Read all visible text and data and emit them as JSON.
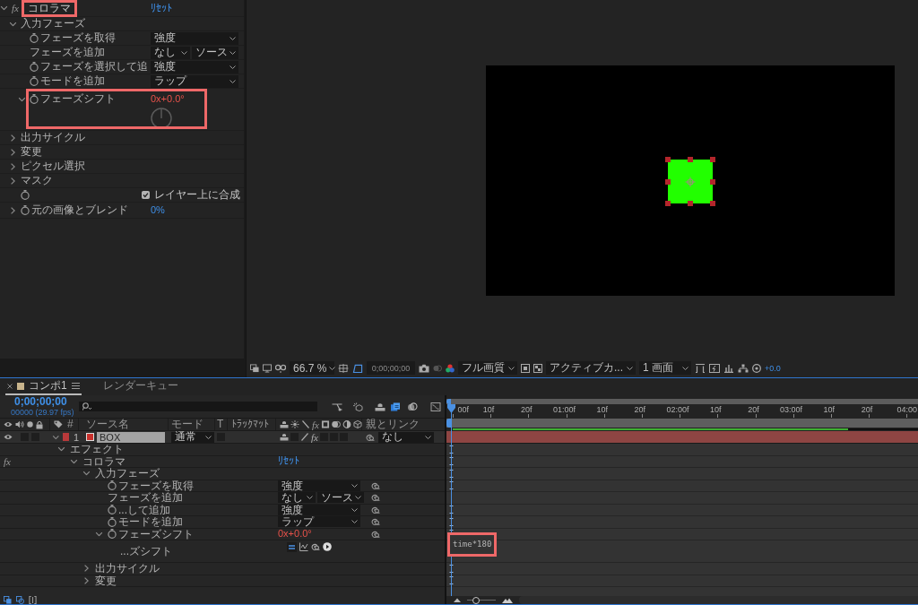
{
  "effect_controls": {
    "effect": {
      "fx_label": "fx",
      "name": "コロラマ",
      "reset": "ﾘｾｯﾄ",
      "expanded": true,
      "highlighted": true
    },
    "properties": [
      {
        "kind": "group",
        "label": "入力フェーズ",
        "expanded": true,
        "children": [
          {
            "kind": "dropdown",
            "label": "フェーズを取得",
            "stopwatch": true,
            "values": [
              "強度"
            ],
            "highlighted": false
          },
          {
            "kind": "dropdown",
            "label": "フェーズを追加",
            "stopwatch": false,
            "values": [
              "なし",
              "ソース"
            ],
            "highlighted": false
          },
          {
            "kind": "dropdown",
            "label": "フェーズを選択して追",
            "stopwatch": true,
            "values": [
              "強度"
            ],
            "highlighted": false
          },
          {
            "kind": "dropdown",
            "label": "モードを追加",
            "stopwatch": true,
            "values": [
              "ラップ"
            ],
            "highlighted": false
          },
          {
            "kind": "angle",
            "label": "フェーズシフト",
            "stopwatch": true,
            "expanded": true,
            "expression": true,
            "value": "0x+0.0°",
            "highlighted": true
          }
        ]
      },
      {
        "kind": "group",
        "label": "出力サイクル",
        "expanded": false
      },
      {
        "kind": "group",
        "label": "変更",
        "expanded": false
      },
      {
        "kind": "group",
        "label": "ピクセル選択",
        "expanded": false
      },
      {
        "kind": "group",
        "label": "マスク",
        "expanded": false
      },
      {
        "kind": "checkbox",
        "stopwatch": true,
        "text": "レイヤー上に合成",
        "checked": true
      },
      {
        "kind": "slider",
        "label": "元の画像とブレンド",
        "stopwatch": true,
        "expanded": false,
        "value": "0%"
      }
    ]
  },
  "viewer": {
    "layer": {
      "selected": true
    },
    "toolbar": {
      "zoom": "66.7 %",
      "timecode": "0;00;00;00",
      "quality": "フル画質",
      "camera": "アクティブカ...",
      "views": "1 画面",
      "exposure": "+0.0"
    }
  },
  "timeline": {
    "tabs": [
      {
        "label": "コンポ1",
        "selected": true
      },
      {
        "label": "レンダーキュー",
        "selected": false
      }
    ],
    "current_time": "0;00;00;00",
    "frame_info": "00000 (29.97 fps)",
    "columns": {
      "number": "#",
      "source_name": "ソース名",
      "mode": "モード",
      "t": "T",
      "track_matte": "ﾄﾗｯｸﾏｯﾄ",
      "effects": "fx",
      "parent": "親とリンク"
    },
    "layer": {
      "number": "1",
      "name": "BOX",
      "mode": "通常",
      "effects": "fx",
      "effects_enabled": true,
      "parent": "なし",
      "visible": true,
      "expanded": true,
      "selected": true
    },
    "ruler": [
      "00f",
      "10f",
      "20f",
      "01:00f",
      "10f",
      "20f",
      "02:00f",
      "10f",
      "20f",
      "03:00f",
      "10f",
      "20f",
      "04:00"
    ],
    "cache": {
      "level": 0.85
    },
    "zoom_slider": {
      "level": 0.3
    },
    "tree": [
      {
        "kind": "group",
        "label": "エフェクト",
        "expanded": true,
        "children": [
          {
            "kind": "effect",
            "fx_label": "fx",
            "label": "コロラマ",
            "reset": "ﾘｾｯﾄ",
            "expanded": true,
            "children": [
              {
                "kind": "group",
                "label": "入力フェーズ",
                "expanded": true,
                "children": [
                  {
                    "kind": "dropdown",
                    "label": "フェーズを取得",
                    "stopwatch": true,
                    "values": [
                      "強度"
                    ]
                  },
                  {
                    "kind": "dropdown",
                    "label": "フェーズを追加",
                    "stopwatch": false,
                    "values": [
                      "なし",
                      "ソース"
                    ]
                  },
                  {
                    "kind": "dropdown",
                    "label": "...して追加",
                    "stopwatch": true,
                    "values": [
                      "強度"
                    ]
                  },
                  {
                    "kind": "dropdown",
                    "label": "モードを追加",
                    "stopwatch": true,
                    "values": [
                      "ラップ"
                    ]
                  },
                  {
                    "kind": "angle",
                    "label": "フェーズシフト",
                    "stopwatch": true,
                    "expanded": true,
                    "expression": true,
                    "value": "0x+0.0°",
                    "children": [
                      {
                        "kind": "expression",
                        "label": "...ズシフト",
                        "code": "time*180",
                        "highlighted": true
                      }
                    ]
                  }
                ]
              },
              {
                "kind": "group",
                "label": "出力サイクル",
                "expanded": false
              },
              {
                "kind": "group",
                "label": "変更",
                "expanded": false
              }
            ]
          }
        ]
      }
    ]
  }
}
